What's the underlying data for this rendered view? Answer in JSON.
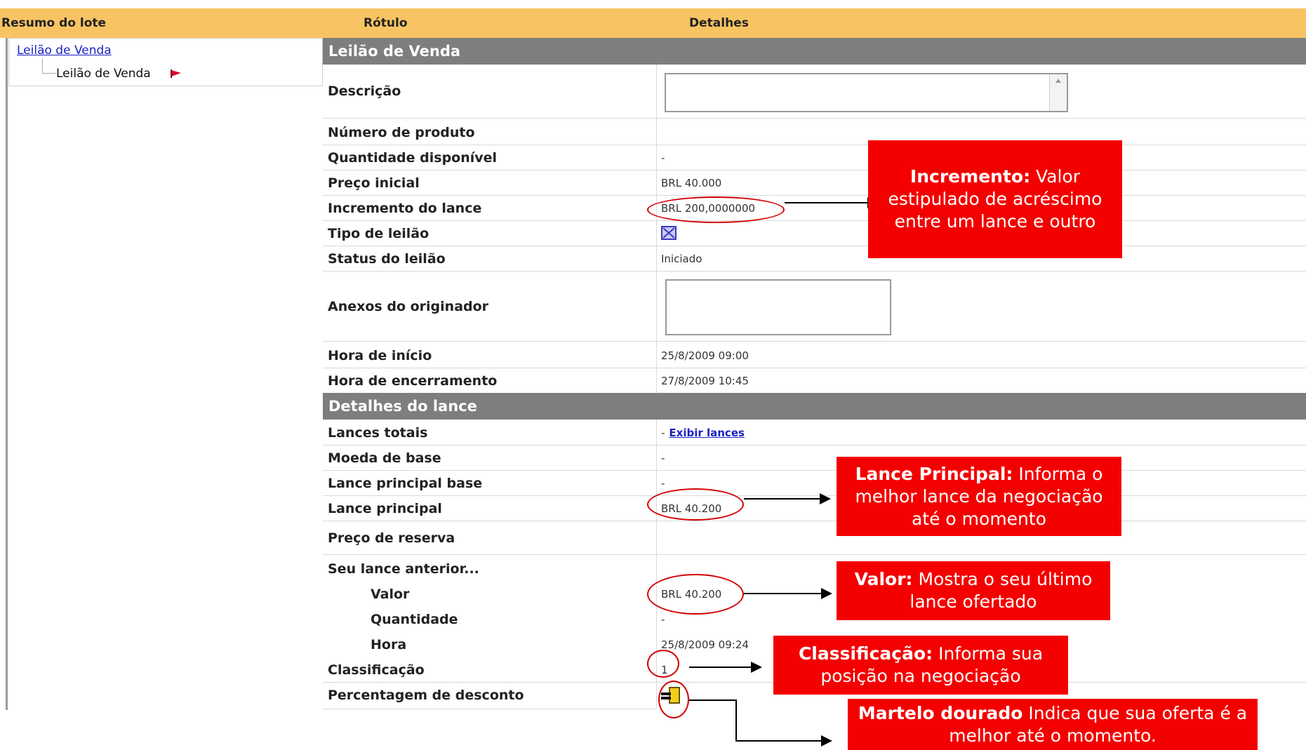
{
  "header": {
    "left": "Resumo do lote",
    "label_col": "Rótulo",
    "details_col": "Detalhes"
  },
  "tree": {
    "root": "Leilão de Venda",
    "child": "Leilão de Venda"
  },
  "sections": {
    "auction": "Leilão de Venda",
    "bid": "Detalhes do lance"
  },
  "auction_rows": {
    "descricao": {
      "label": "Descrição",
      "value": ""
    },
    "numero_produto": {
      "label": "Número de produto",
      "value": ""
    },
    "quantidade": {
      "label": "Quantidade disponível",
      "value": "-"
    },
    "preco_inicial": {
      "label": "Preço inicial",
      "value": "BRL 40.000"
    },
    "incremento": {
      "label": "Incremento do lance",
      "value": "BRL 200,0000000"
    },
    "tipo": {
      "label": "Tipo de leilão",
      "value": ""
    },
    "status": {
      "label": "Status do leilão",
      "value": "Iniciado"
    },
    "anexos": {
      "label": "Anexos do originador",
      "value": ""
    },
    "hora_inicio": {
      "label": "Hora de início",
      "value": "25/8/2009 09:00"
    },
    "hora_fim": {
      "label": "Hora de encerramento",
      "value": "27/8/2009 10:45"
    }
  },
  "bid_rows": {
    "lances_totais": {
      "label": "Lances totais",
      "dash": "-",
      "link": "Exibir lances"
    },
    "moeda_base": {
      "label": "Moeda de base",
      "value": "-"
    },
    "lance_principal_base": {
      "label": "Lance principal base",
      "value": "-"
    },
    "lance_principal": {
      "label": "Lance principal",
      "value": "BRL 40.200"
    },
    "preco_reserva": {
      "label": "Preço de reserva",
      "value": ""
    },
    "seu_lance": {
      "label": "Seu lance anterior...",
      "value": ""
    },
    "valor": {
      "label": "Valor",
      "value": "BRL 40.200"
    },
    "quantidade": {
      "label": "Quantidade",
      "value": "-"
    },
    "hora": {
      "label": "Hora",
      "value": "25/8/2009 09:24"
    },
    "classificacao": {
      "label": "Classificação",
      "value": "1"
    },
    "percentagem": {
      "label": "Percentagem de desconto",
      "value": ""
    }
  },
  "annotations": {
    "incremento": {
      "title": "Incremento:",
      "text": "Valor estipulado de acréscimo entre um lance e outro"
    },
    "lance_principal": {
      "title": "Lance Principal:",
      "text": "Informa o melhor lance da negociação até o momento"
    },
    "valor": {
      "title": "Valor:",
      "text": "Mostra o seu último lance ofertado"
    },
    "classificacao": {
      "title": "Classificação:",
      "text": "Informa sua posição na negociação"
    },
    "martelo": {
      "title": "Martelo dourado",
      "text": "Indica que sua oferta é a melhor até o momento."
    }
  },
  "colors": {
    "header_bg": "#f8c463",
    "section_bg": "#7e7e7e",
    "annotation_bg": "#f40000",
    "link": "#1a22c2"
  }
}
